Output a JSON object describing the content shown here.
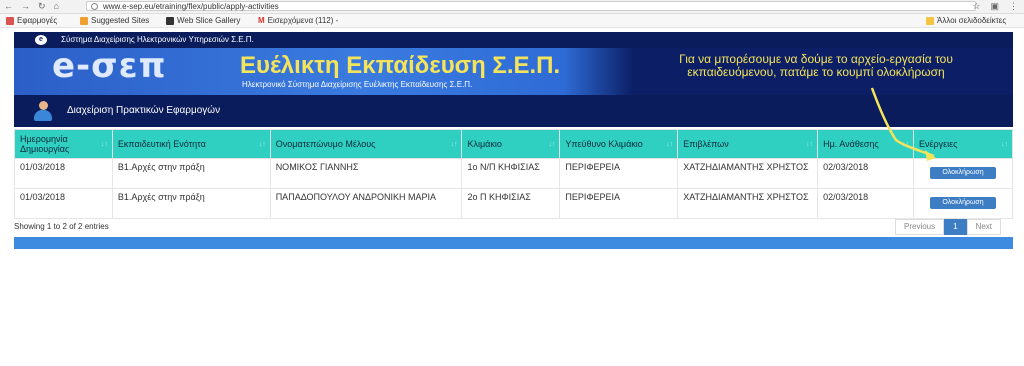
{
  "browser": {
    "url": "www.e-sep.eu/etraining/flex/public/apply-activities",
    "bookmarks": [
      "Εφαρμογές",
      "Suggested Sites",
      "Web Slice Gallery",
      "Εισερχόμενα (112) -",
      "Άλλοι σελιδοδείκτες"
    ]
  },
  "banner": {
    "system_name": "Σύστημα Διαχείρισης Ηλεκτρονικών Υπηρεσιών Σ.Ε.Π.",
    "logo": "e-σεπ",
    "title": "Ευέλικτη Εκπαίδευση Σ.Ε.Π.",
    "subtitle": "Ηλεκτρονικό Σύστημα Διαχείρισης Ευέλικτης Εκπαίδευσης Σ.Ε.Π.",
    "annotation": "Για να μπορέσουμε να δούμε το αρχείο-εργασία του εκπαιδευόμενου, πατάμε το κουμπί ολοκλήρωση",
    "section": "Διαχείριση Πρακτικών Εφαρμογών"
  },
  "table": {
    "headers": [
      "Ημερομηνία Δημιουργίας",
      "Εκπαιδευτική Ενότητα",
      "Ονοματεπώνυμο Μέλους",
      "Κλιμάκιο",
      "Υπεύθυνο Κλιμάκιο",
      "Επιβλέπων",
      "Ημ. Ανάθεσης",
      "Ενέργειες"
    ],
    "rows": [
      [
        "01/03/2018",
        "Β1.Αρχές στην πράξη",
        "ΝΟΜΙΚΟΣ ΓΙΑΝΝΗΣ",
        "1ο Ν/Π ΚΗΦΙΣΙΑΣ",
        "ΠΕΡΙΦΕΡΕΙΑ",
        "ΧΑΤΖΗΔΙΑΜΑΝΤΗΣ ΧΡΗΣΤΟΣ",
        "02/03/2018",
        "Ολοκλήρωση"
      ],
      [
        "01/03/2018",
        "Β1.Αρχές στην πράξη",
        "ΠΑΠΑΔΟΠΟΥΛΟΥ ΑΝΔΡΟΝΙΚΗ ΜΑΡΙΑ",
        "2ο Π ΚΗΦΙΣΙΑΣ",
        "ΠΕΡΙΦΕΡΕΙΑ",
        "ΧΑΤΖΗΔΙΑΜΑΝΤΗΣ ΧΡΗΣΤΟΣ",
        "02/03/2018",
        "Ολοκλήρωση"
      ]
    ]
  },
  "footer": {
    "info": "Showing 1 to 2 of 2 entries",
    "previous": "Previous",
    "page": "1",
    "next": "Next"
  },
  "colors": {
    "header_bg": "#2fcfc2",
    "banner_bg": "#0c1f66",
    "title_yellow": "#f5e45a",
    "button_blue": "#3d7dc4"
  }
}
